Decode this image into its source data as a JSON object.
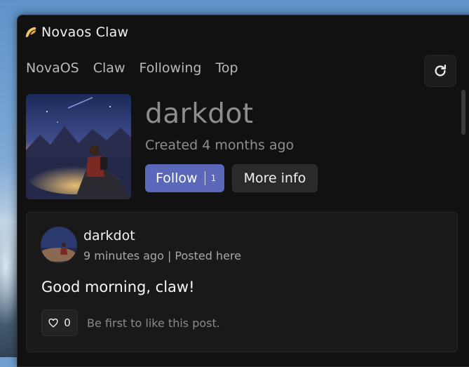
{
  "window": {
    "title": "Novaos Claw"
  },
  "nav": {
    "items": [
      "NovaOS",
      "Claw",
      "Following",
      "Top"
    ]
  },
  "profile": {
    "name": "darkdot",
    "created": "Created 4 months ago",
    "follow_label": "Follow",
    "follow_count": "1",
    "more_info_label": "More info"
  },
  "post": {
    "author": "darkdot",
    "meta": "9 minutes ago | Posted here",
    "text": "Good morning, claw!",
    "like_count": "0",
    "like_hint": "Be first to like this post."
  },
  "icons": {
    "app": "novaos-claw-logo-icon",
    "refresh": "refresh-icon",
    "like": "heart-icon"
  },
  "colors": {
    "accent": "#5b67b8",
    "window_bg": "#111111",
    "card_bg": "#191919"
  }
}
